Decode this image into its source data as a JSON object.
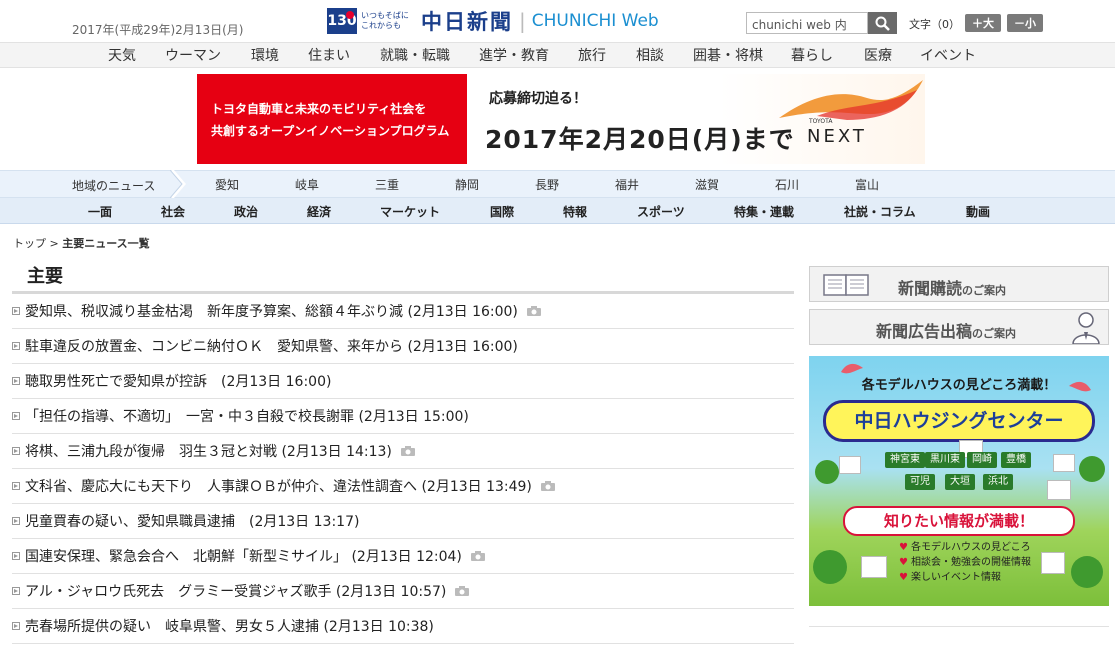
{
  "header": {
    "date": "2017年(平成29年)2月13日(月)",
    "logo": {
      "anniversary": "130",
      "tagline": "いつもそばに これからも",
      "name": "中日新聞",
      "sub": "CHUNICHI Web"
    },
    "search_value": "chunichi web 内",
    "font_size": {
      "label": "文字（0）",
      "bigger": "＋大",
      "smaller": "－小"
    }
  },
  "genre_nav": [
    "天気",
    "ウーマン",
    "環境",
    "住まい",
    "就職・転職",
    "進学・教育",
    "旅行",
    "相談",
    "囲碁・将棋",
    "暮らし",
    "医療",
    "イベント"
  ],
  "banner": {
    "left_text": [
      "トヨタ自動車と未来のモビリティ社会を",
      "共創するオープンイノベーションプログラム"
    ],
    "small": "応募締切迫る！",
    "big": "2017年2月20日(月)まで",
    "brand_tag": "TOYOTA",
    "brand": "NEXT"
  },
  "region_nav": {
    "title": "地域のニュース",
    "items": [
      "愛知",
      "岐阜",
      "三重",
      "静岡",
      "長野",
      "福井",
      "滋賀",
      "石川",
      "富山"
    ]
  },
  "category_nav": [
    "一面",
    "社会",
    "政治",
    "経済",
    "マーケット",
    "国際",
    "特報",
    "スポーツ",
    "特集・連載",
    "社説・コラム",
    "動画"
  ],
  "breadcrumb": {
    "top": "トップ",
    "separator": ">",
    "current": "主要ニュース一覧"
  },
  "page_title": "主要",
  "news": [
    {
      "text": "愛知県、税収減り基金枯渇　新年度予算案、総額４年ぶり減 (2月13日 16:00)",
      "camera": true
    },
    {
      "text": "駐車違反の放置金、コンビニ納付ＯＫ　愛知県警、来年から (2月13日 16:00)",
      "camera": false
    },
    {
      "text": "聴取男性死亡で愛知県が控訴　(2月13日 16:00)",
      "camera": false
    },
    {
      "text": "「担任の指導、不適切」　一宮・中３自殺で校長謝罪 (2月13日 15:00)",
      "camera": false
    },
    {
      "text": "将棋、三浦九段が復帰　羽生３冠と対戦 (2月13日 14:13)",
      "camera": true
    },
    {
      "text": "文科省、慶応大にも天下り　人事課ＯＢが仲介、違法性調査へ (2月13日 13:49)",
      "camera": true
    },
    {
      "text": "児童買春の疑い、愛知県職員逮捕　(2月13日 13:17)",
      "camera": false
    },
    {
      "text": "国連安保理、緊急会合へ　北朝鮮「新型ミサイル」 (2月13日 12:04)",
      "camera": true
    },
    {
      "text": "アル・ジャロウ氏死去　グラミー受賞ジャズ歌手 (2月13日 10:57)",
      "camera": true
    },
    {
      "text": "売春場所提供の疑い　岐阜県警、男女５人逮捕 (2月13日 10:38)",
      "camera": false
    }
  ],
  "sidebar": {
    "subscribe": {
      "big": "新聞購読",
      "small": "のご案内"
    },
    "ad": {
      "big": "新聞広告出稿",
      "small": "のご案内"
    },
    "housing": {
      "top": "各モデルハウスの見どころ満載！",
      "title": "中日ハウジングセンター",
      "places": [
        "神宮東",
        "黒川東",
        "岡崎",
        "豊橋",
        "可児",
        "大垣",
        "浜北"
      ],
      "headline": "知りたい情報が満載！",
      "list": [
        "各モデルハウスの見どころ",
        "相談会・勉強会の開催情報",
        "楽しいイベント情報"
      ]
    }
  },
  "colors": {
    "brand_blue": "#1b3f8b",
    "brand_red": "#e6002d",
    "banner_red": "#e60012",
    "region_bg": "#eaf2fb",
    "category_bg": "#e3edf8"
  }
}
